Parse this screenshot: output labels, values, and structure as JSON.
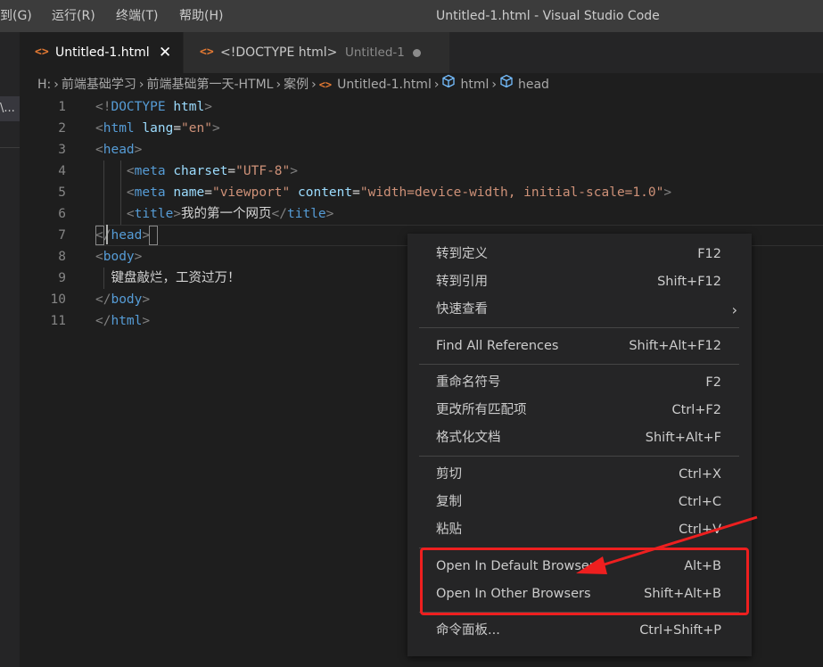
{
  "menubar": {
    "items": [
      "到(G)",
      "运行(R)",
      "终端(T)",
      "帮助(H)"
    ],
    "window_title": "Untitled-1.html - Visual Studio Code"
  },
  "sidebar": {
    "fragment": "\\..."
  },
  "tabs": [
    {
      "icon": "<>",
      "label": "Untitled-1.html",
      "close": "✕"
    },
    {
      "icon": "<>",
      "label": "<!DOCTYPE html>",
      "secondary": "Untitled-1"
    }
  ],
  "breadcrumb": {
    "drive": "H:",
    "folders": [
      "前端基础学习",
      "前端基础第一天-HTML",
      "案例"
    ],
    "file": "Untitled-1.html",
    "symbols": [
      "html",
      "head"
    ]
  },
  "editor": {
    "lines": [
      {
        "n": "1",
        "tokens": [
          [
            "br",
            "<!"
          ],
          [
            "tag",
            "DOCTYPE"
          ],
          [
            "txt",
            " "
          ],
          [
            "attr",
            "html"
          ],
          [
            "br",
            ">"
          ]
        ]
      },
      {
        "n": "2",
        "tokens": [
          [
            "br",
            "<"
          ],
          [
            "tag",
            "html"
          ],
          [
            "txt",
            " "
          ],
          [
            "attr",
            "lang"
          ],
          [
            "txt",
            "="
          ],
          [
            "str",
            "\"en\""
          ],
          [
            "br",
            ">"
          ]
        ]
      },
      {
        "n": "3",
        "tokens": [
          [
            "br",
            "<"
          ],
          [
            "tag",
            "head"
          ],
          [
            "br",
            ">"
          ]
        ]
      },
      {
        "n": "4",
        "tokens": [
          [
            "txt",
            "    "
          ],
          [
            "br",
            "<"
          ],
          [
            "tag",
            "meta"
          ],
          [
            "txt",
            " "
          ],
          [
            "attr",
            "charset"
          ],
          [
            "txt",
            "="
          ],
          [
            "str",
            "\"UTF-8\""
          ],
          [
            "br",
            ">"
          ]
        ]
      },
      {
        "n": "5",
        "tokens": [
          [
            "txt",
            "    "
          ],
          [
            "br",
            "<"
          ],
          [
            "tag",
            "meta"
          ],
          [
            "txt",
            " "
          ],
          [
            "attr",
            "name"
          ],
          [
            "txt",
            "="
          ],
          [
            "str",
            "\"viewport\""
          ],
          [
            "txt",
            " "
          ],
          [
            "attr",
            "content"
          ],
          [
            "txt",
            "="
          ],
          [
            "str",
            "\"width=device-width, initial-scale=1.0\""
          ],
          [
            "br",
            ">"
          ]
        ]
      },
      {
        "n": "6",
        "tokens": [
          [
            "txt",
            "    "
          ],
          [
            "br",
            "<"
          ],
          [
            "tag",
            "title"
          ],
          [
            "br",
            ">"
          ],
          [
            "txt",
            "我的第一个网页"
          ],
          [
            "br",
            "</"
          ],
          [
            "tag",
            "title"
          ],
          [
            "br",
            ">"
          ]
        ]
      },
      {
        "n": "7",
        "tokens": [
          [
            "br",
            "</"
          ],
          [
            "tag",
            "head"
          ],
          [
            "br",
            ">"
          ]
        ]
      },
      {
        "n": "8",
        "tokens": [
          [
            "br",
            "<"
          ],
          [
            "tag",
            "body"
          ],
          [
            "br",
            ">"
          ]
        ]
      },
      {
        "n": "9",
        "tokens": [
          [
            "txt",
            "  键盘敲烂，工资过万！"
          ]
        ]
      },
      {
        "n": "10",
        "tokens": [
          [
            "br",
            "</"
          ],
          [
            "tag",
            "body"
          ],
          [
            "br",
            ">"
          ]
        ]
      },
      {
        "n": "11",
        "tokens": [
          [
            "br",
            "</"
          ],
          [
            "tag",
            "html"
          ],
          [
            "br",
            ">"
          ]
        ]
      }
    ]
  },
  "context_menu": {
    "groups": [
      [
        {
          "label": "转到定义",
          "key": "F12"
        },
        {
          "label": "转到引用",
          "key": "Shift+F12"
        },
        {
          "label": "快速查看",
          "key": "",
          "submenu": "›"
        }
      ],
      [
        {
          "label": "Find All References",
          "key": "Shift+Alt+F12"
        }
      ],
      [
        {
          "label": "重命名符号",
          "key": "F2"
        },
        {
          "label": "更改所有匹配项",
          "key": "Ctrl+F2"
        },
        {
          "label": "格式化文档",
          "key": "Shift+Alt+F"
        }
      ],
      [
        {
          "label": "剪切",
          "key": "Ctrl+X"
        },
        {
          "label": "复制",
          "key": "Ctrl+C"
        },
        {
          "label": "粘贴",
          "key": "Ctrl+V"
        }
      ],
      [
        {
          "label": "Open In Default Browser",
          "key": "Alt+B"
        },
        {
          "label": "Open In Other Browsers",
          "key": "Shift+Alt+B"
        }
      ],
      [
        {
          "label": "命令面板...",
          "key": "Ctrl+Shift+P"
        }
      ]
    ]
  },
  "colors": {
    "accent_orange": "#e37933",
    "highlight_red": "#ee1f1f",
    "tag_blue": "#569cd6",
    "attr_lightblue": "#9cdcfe",
    "string_orange": "#ce9178"
  }
}
